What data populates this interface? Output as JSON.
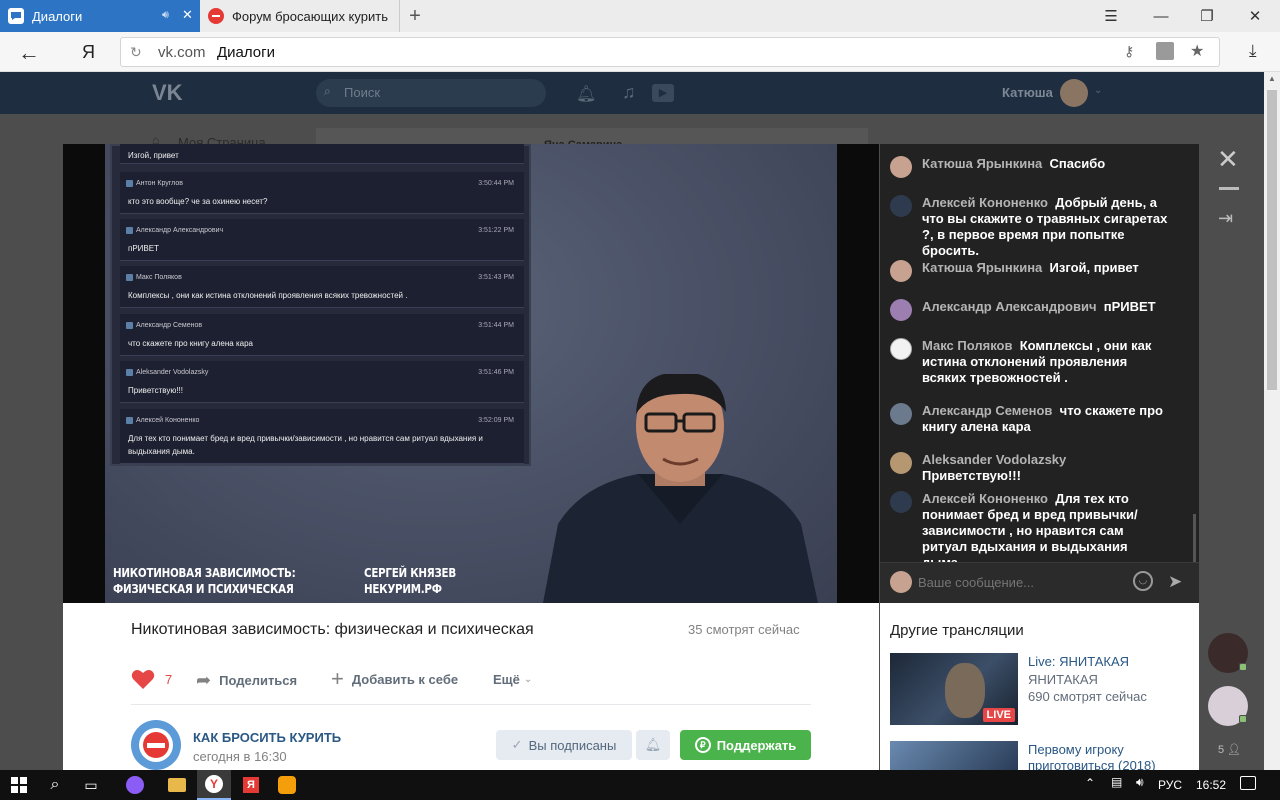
{
  "browser": {
    "tabs": [
      {
        "title": "Диалоги",
        "active": true
      },
      {
        "title": "Форум бросающих курить",
        "active": false
      }
    ],
    "new_tab": "+",
    "yandex_letter": "Я",
    "url_domain": "vk.com",
    "url_title": "Диалоги"
  },
  "vk_header": {
    "logo": "VK",
    "search_placeholder": "Поиск",
    "user_name": "Катюша"
  },
  "sidebar_peek": {
    "my_page": "Моя Страница"
  },
  "dialog_peek": {
    "name": "Яна Самарина"
  },
  "video_overlay": {
    "messages": [
      {
        "name": "Изгой, привет",
        "time": "",
        "text": ""
      },
      {
        "name": "Антон Круглов",
        "time": "3:50:44 PM",
        "text": "кто это вообще? че за охинею несет?"
      },
      {
        "name": "Александр Александрович",
        "time": "3:51:22 PM",
        "text": "пРИВЕТ"
      },
      {
        "name": "Макс Поляков",
        "time": "3:51:43 PM",
        "text": "Комплексы , они как истина отклонений проявления всяких тревожностей ."
      },
      {
        "name": "Александр Семенов",
        "time": "3:51:44 PM",
        "text": "что скажете про книгу алена кара"
      },
      {
        "name": "Aleksander Vodolazsky",
        "time": "3:51:46 PM",
        "text": "Приветствую!!!"
      },
      {
        "name": "Алексей Кононенко",
        "time": "3:52:09 PM",
        "text": "Для тех кто понимает бред и вред привычки/зависимости , но нравится сам ритуал вдыхания и выдыхания дыма."
      }
    ],
    "caption_left_1": "Никотиновая зависимость:",
    "caption_left_2": "физическая и психическая",
    "caption_right_1": "Сергей Князев",
    "caption_right_2": "некурим.рф"
  },
  "live_chat": {
    "messages": [
      {
        "name": "Катюша Ярынкина",
        "text": "Спасибо"
      },
      {
        "name": "Алексей Кононенко",
        "text": "Добрый день, а что вы скажите о травяных сигаретах ?, в первое время при попытке бросить."
      },
      {
        "name": "Катюша Ярынкина",
        "text": "Изгой, привет"
      },
      {
        "name": "Александр Александрович",
        "text": "пРИВЕТ"
      },
      {
        "name": "Макс Поляков",
        "text": "Комплексы , они как истина отклонений проявления всяких тревожностей ."
      },
      {
        "name": "Александр Семенов",
        "text": "что скажете про книгу алена кара"
      },
      {
        "name": "Aleksander Vodolazsky",
        "text": "Приветствую!!!"
      },
      {
        "name": "Алексей Кононенко",
        "text": "Для тех кто понимает бред и вред привычки/ зависимости , но нравится сам ритуал вдыхания и выдыхания дыма."
      }
    ],
    "input_placeholder": "Ваше сообщение..."
  },
  "video_info": {
    "title": "Никотиновая зависимость: физическая и психическая",
    "viewers": "35 смотрят сейчас",
    "likes": "7",
    "share": "Поделиться",
    "add": "Добавить к себе",
    "more": "Ещё",
    "channel_name": "КАК БРОСИТЬ КУРИТЬ",
    "channel_time": "сегодня в 16:30",
    "subscribed": "Вы подписаны",
    "support": "Поддержать"
  },
  "other_streams": {
    "header": "Другие трансляции",
    "items": [
      {
        "title": "Live: ЯНИТАКАЯ",
        "author": "ЯНИТАКАЯ",
        "viewers": "690 смотрят сейчас",
        "badge": "LIVE"
      },
      {
        "title": "Первому игроку приготовиться (2018)",
        "author": "",
        "viewers": "",
        "badge": ""
      }
    ]
  },
  "right_rail": {
    "count": "5"
  },
  "taskbar": {
    "lang": "РУС",
    "time": "16:52"
  },
  "colors": {
    "vk_header": "#1e2d3f",
    "tab_active": "#2d74c4",
    "like_red": "#e64646",
    "support_green": "#4bb34b",
    "link_blue": "#2a5885"
  }
}
